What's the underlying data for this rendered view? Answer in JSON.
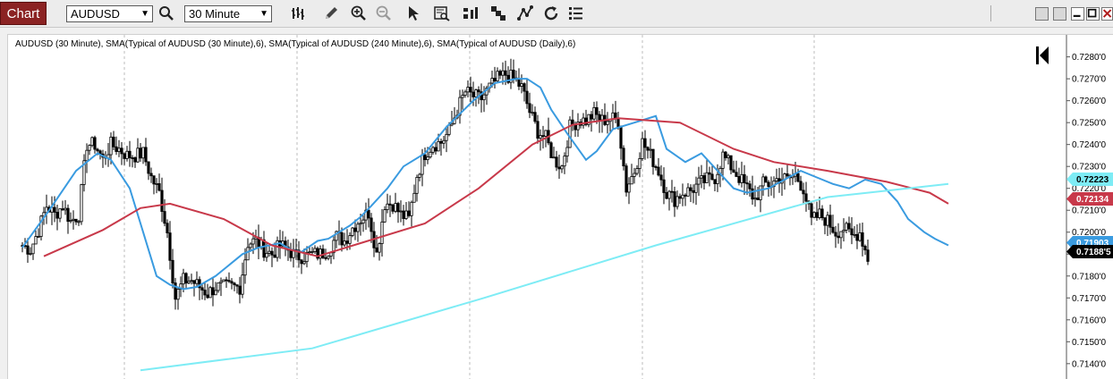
{
  "toolbar": {
    "chart_tab_label": "Chart",
    "symbol_value": "AUDUSD",
    "interval_value": "30 Minute",
    "icons": [
      "bar-type-icon",
      "pencil-icon",
      "zoom-in-icon",
      "zoom-out-icon",
      "cursor-arrow-icon",
      "data-box-icon",
      "indicators-icon",
      "pattern-icon",
      "draw-tools-icon",
      "refresh-icon",
      "list-icon"
    ]
  },
  "chart": {
    "title": "AUDUSD (30 Minute), SMA(Typical of AUDUSD (30 Minute),6), SMA(Typical of AUDUSD (240 Minute),6), SMA(Typical of AUDUSD (Daily),6)",
    "colors": {
      "candle": "#000000",
      "sma30": "#3a9be0",
      "sma240": "#c8394a",
      "smaDaily": "#7eecf5"
    },
    "badges": {
      "daily": "0.72223",
      "sma240": "0.72134",
      "sma30": "0.71903",
      "last": "0.7188'5"
    }
  },
  "chart_data": {
    "type": "candlestick",
    "yaxis": {
      "ticks": [
        "0.7280'0",
        "0.7270'0",
        "0.7260'0",
        "0.7250'0",
        "0.7240'0",
        "0.7230'0",
        "0.7220'0",
        "0.7210'0",
        "0.7200'0",
        "0.7190'0",
        "0.7180'0",
        "0.7170'0",
        "0.7160'0",
        "0.7150'0",
        "0.7140'0"
      ],
      "ylim": [
        0.7133,
        0.7288
      ]
    },
    "close_path": [
      0.7194,
      0.7192,
      0.7201,
      0.7212,
      0.7208,
      0.7212,
      0.7205,
      0.7208,
      0.724,
      0.724,
      0.7233,
      0.724,
      0.7238,
      0.7235,
      0.7235,
      0.7236,
      0.7225,
      0.7218,
      0.72,
      0.717,
      0.7178,
      0.7178,
      0.7175,
      0.7172,
      0.7175,
      0.7175,
      0.7175,
      0.7175,
      0.7195,
      0.7196,
      0.7192,
      0.719,
      0.7194,
      0.7192,
      0.7189,
      0.7189,
      0.719,
      0.719,
      0.7192,
      0.7198,
      0.7196,
      0.7202,
      0.7206,
      0.7209,
      0.719,
      0.7213,
      0.7213,
      0.7208,
      0.7206,
      0.7226,
      0.7236,
      0.724,
      0.7241,
      0.7246,
      0.7256,
      0.7264,
      0.7262,
      0.7261,
      0.7266,
      0.727,
      0.7272,
      0.727,
      0.7266,
      0.7255,
      0.7246,
      0.7243,
      0.7233,
      0.723,
      0.7248,
      0.7251,
      0.7251,
      0.7254,
      0.7251,
      0.7252,
      0.7251,
      0.722,
      0.7228,
      0.7241,
      0.7235,
      0.7228,
      0.7218,
      0.7215,
      0.7218,
      0.7219,
      0.7222,
      0.7224,
      0.7225,
      0.7235,
      0.723,
      0.7225,
      0.722,
      0.7215,
      0.7222,
      0.7222,
      0.7225,
      0.7224,
      0.7226,
      0.722,
      0.7205,
      0.7208,
      0.7205,
      0.72,
      0.7202,
      0.7198,
      0.72,
      0.7188
    ],
    "series": [
      {
        "name": "SMA(Typical of AUDUSD (30 Minute),6)",
        "color": "#3a9be0",
        "values": [
          [
            0,
            0.7193
          ],
          [
            10,
            0.721
          ],
          [
            20,
            0.7228
          ],
          [
            28,
            0.7236
          ],
          [
            33,
            0.7233
          ],
          [
            40,
            0.722
          ],
          [
            45,
            0.72
          ],
          [
            50,
            0.718
          ],
          [
            55,
            0.7176
          ],
          [
            60,
            0.7174
          ],
          [
            65,
            0.7175
          ],
          [
            72,
            0.718
          ],
          [
            82,
            0.719
          ],
          [
            88,
            0.7193
          ],
          [
            96,
            0.7195
          ],
          [
            100,
            0.7192
          ],
          [
            104,
            0.7191
          ],
          [
            110,
            0.7196
          ],
          [
            114,
            0.7197
          ],
          [
            118,
            0.72
          ],
          [
            122,
            0.7203
          ],
          [
            126,
            0.7207
          ],
          [
            130,
            0.7212
          ],
          [
            136,
            0.722
          ],
          [
            142,
            0.723
          ],
          [
            150,
            0.7236
          ],
          [
            158,
            0.7248
          ],
          [
            168,
            0.726
          ],
          [
            176,
            0.7268
          ],
          [
            184,
            0.727
          ],
          [
            188,
            0.727
          ],
          [
            193,
            0.7266
          ],
          [
            197,
            0.7256
          ],
          [
            203,
            0.7245
          ],
          [
            210,
            0.7233
          ],
          [
            214,
            0.7237
          ],
          [
            220,
            0.7247
          ],
          [
            228,
            0.725
          ],
          [
            236,
            0.7253
          ],
          [
            240,
            0.7238
          ],
          [
            247,
            0.7232
          ],
          [
            253,
            0.7236
          ],
          [
            259,
            0.7228
          ],
          [
            265,
            0.722
          ],
          [
            270,
            0.7218
          ],
          [
            278,
            0.722
          ],
          [
            284,
            0.7224
          ],
          [
            290,
            0.7228
          ],
          [
            296,
            0.7225
          ],
          [
            302,
            0.7222
          ],
          [
            308,
            0.722
          ],
          [
            314,
            0.7224
          ],
          [
            320,
            0.7222
          ],
          [
            326,
            0.7214
          ],
          [
            330,
            0.7206
          ],
          [
            336,
            0.72
          ],
          [
            340,
            0.7197
          ],
          [
            345,
            0.7194
          ]
        ]
      },
      {
        "name": "SMA(Typical of AUDUSD (240 Minute),6)",
        "color": "#c8394a",
        "values": [
          [
            8,
            0.7189
          ],
          [
            30,
            0.7201
          ],
          [
            44,
            0.7211
          ],
          [
            55,
            0.7213
          ],
          [
            75,
            0.7206
          ],
          [
            93,
            0.7194
          ],
          [
            110,
            0.7189
          ],
          [
            126,
            0.7195
          ],
          [
            150,
            0.7204
          ],
          [
            170,
            0.722
          ],
          [
            190,
            0.724
          ],
          [
            205,
            0.7249
          ],
          [
            222,
            0.7252
          ],
          [
            245,
            0.725
          ],
          [
            265,
            0.7238
          ],
          [
            280,
            0.7232
          ],
          [
            300,
            0.7228
          ],
          [
            322,
            0.7223
          ],
          [
            338,
            0.7218
          ],
          [
            345,
            0.7213
          ]
        ]
      },
      {
        "name": "SMA(Typical of AUDUSD (Daily),6)",
        "color": "#7eecf5",
        "values": [
          [
            44,
            0.7137
          ],
          [
            108,
            0.7147
          ],
          [
            172,
            0.717
          ],
          [
            236,
            0.7194
          ],
          [
            300,
            0.7216
          ],
          [
            345,
            0.7222
          ]
        ]
      }
    ]
  }
}
